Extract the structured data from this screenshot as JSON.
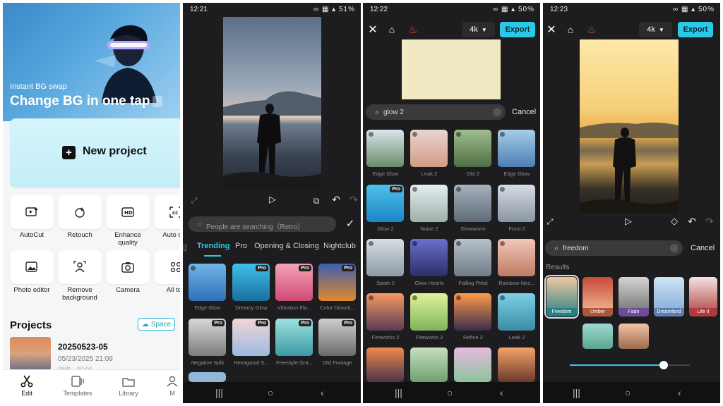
{
  "p1": {
    "banner_sub": "Instant BG swap",
    "banner_title": "Change BG in one tap",
    "new_project": "New project",
    "tools": [
      {
        "label": "AutoCut",
        "icon": "autocut-icon"
      },
      {
        "label": "Retouch",
        "icon": "retouch-icon"
      },
      {
        "label": "Enhance quality",
        "icon": "hd-icon"
      },
      {
        "label": "Auto cap",
        "icon": "captions-icon"
      },
      {
        "label": "Photo editor",
        "icon": "photo-editor-icon"
      },
      {
        "label": "Remove background",
        "icon": "remove-bg-icon"
      },
      {
        "label": "Camera",
        "icon": "camera-icon"
      },
      {
        "label": "All too",
        "icon": "grid-icon"
      }
    ],
    "projects_heading": "Projects",
    "space_label": "Space",
    "project": {
      "name": "20250523-05",
      "date": "05/23/2025 21:09",
      "size": "0MB · 00:05"
    },
    "nav": [
      {
        "label": "Edit",
        "icon": "scissors-icon"
      },
      {
        "label": "Templates",
        "icon": "templates-icon"
      },
      {
        "label": "Library",
        "icon": "folder-icon"
      },
      {
        "label": "M",
        "icon": "profile-icon"
      }
    ]
  },
  "p2": {
    "status_time": "12:21",
    "status_battery": "51%",
    "search_placeholder": "People are searching（Retro）",
    "tabs": [
      "Trending",
      "Pro",
      "Opening & Closing",
      "Nightclub"
    ],
    "effects": [
      "Edge Glow",
      "Dreamy Glow",
      "Vibration Fla...",
      "Color Distorti...",
      "Negative Split",
      "Hexagonal S...",
      "Freestyle Gra...",
      "Old Footage"
    ]
  },
  "p3": {
    "status_time": "12:22",
    "status_battery": "50%",
    "resolution": "4k",
    "export": "Export",
    "search_value": "glow 2",
    "cancel": "Cancel",
    "effects": [
      "Edge Glow",
      "Leak 2",
      "Old 2",
      "Edge Glow",
      "Glow 2",
      "Noise 2",
      "Glowworm",
      "Frost 2",
      "Spark 2",
      "Glow Hearts",
      "Falling Petal",
      "Rainbow Neo...",
      "Fireworks 2",
      "Fireworks 2",
      "Refine 2",
      "Leak 2"
    ]
  },
  "p4": {
    "status_time": "12:23",
    "status_battery": "50%",
    "resolution": "4k",
    "export": "Export",
    "search_value": "freedom",
    "cancel": "Cancel",
    "results_label": "Results",
    "filters": [
      "Freedom",
      "Umber",
      "Fade",
      "Dreamland",
      "Life II"
    ],
    "slider_value": 0.78,
    "colors": {
      "freedom": "#2a7f86",
      "umber": "#b0553a",
      "fade": "#6d4c9a",
      "dreamland": "#5c7fb3",
      "life": "#b23a3a"
    }
  },
  "accent": "#31c7e6"
}
